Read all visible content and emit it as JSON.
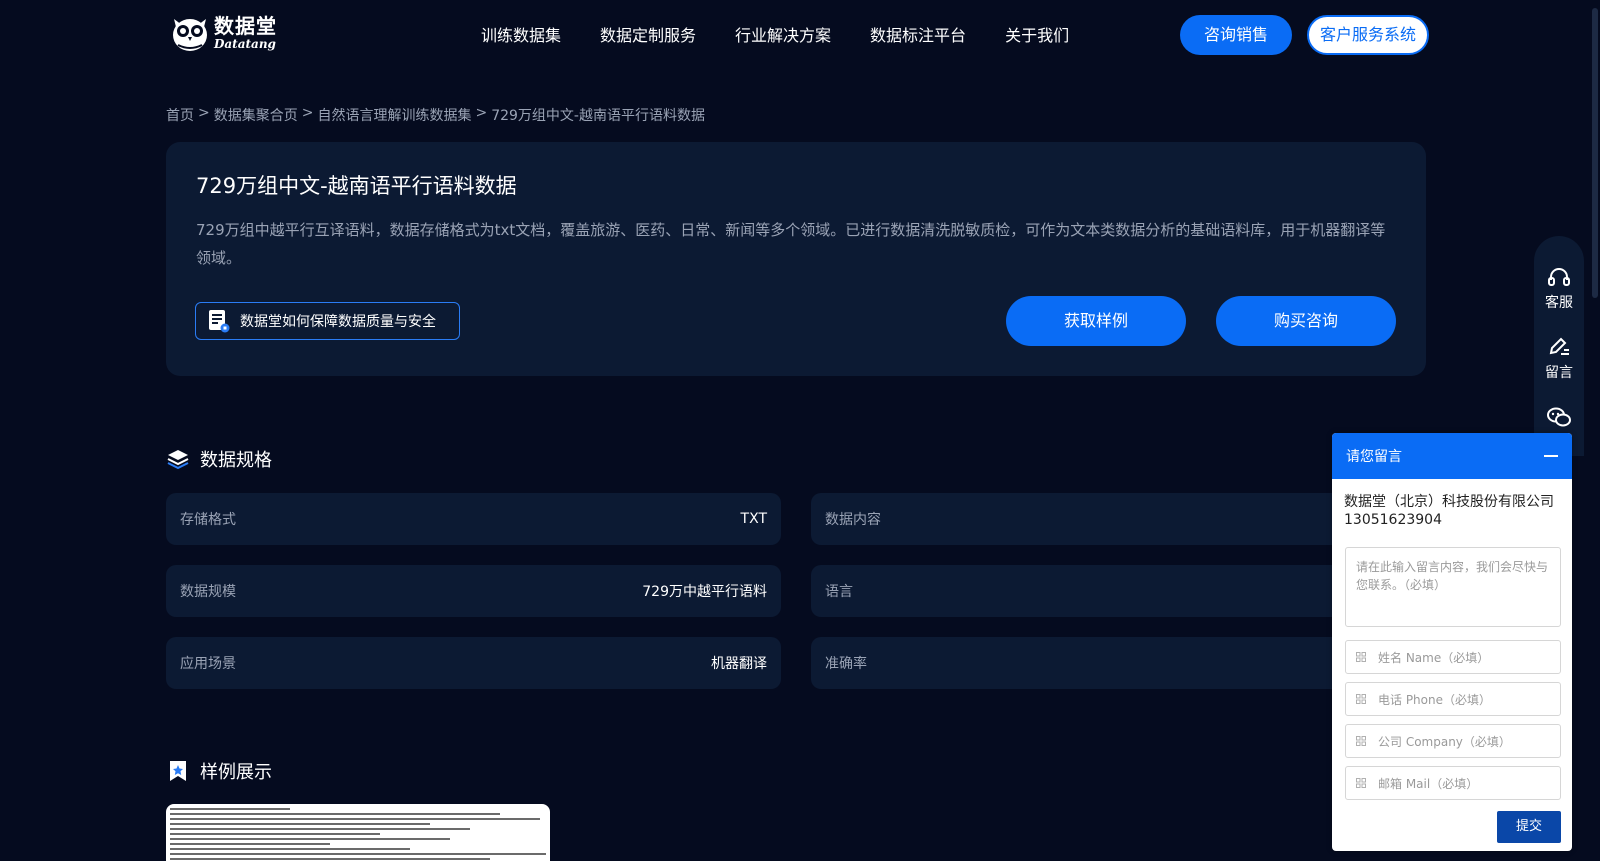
{
  "header": {
    "logo_cn": "数据堂",
    "logo_en": "Datatang",
    "nav": [
      "训练数据集",
      "数据定制服务",
      "行业解决方案",
      "数据标注平台",
      "关于我们"
    ],
    "consult_label": "咨询销售",
    "service_label": "客户服务系统"
  },
  "breadcrumb": {
    "items": [
      "首页",
      "数据集聚合页",
      "自然语言理解训练数据集",
      "729万组中文-越南语平行语料数据"
    ],
    "separator": ">"
  },
  "hero": {
    "title": "729万组中文-越南语平行语料数据",
    "description": "729万组中越平行互译语料，数据存储格式为txt文档，覆盖旅游、医药、日常、新闻等多个领域。已进行数据清洗脱敏质检，可作为文本类数据分析的基础语料库，用于机器翻译等领域。",
    "quality_label": "数据堂如何保障数据质量与安全",
    "sample_label": "获取样例",
    "buy_label": "购买咨询"
  },
  "specs": {
    "title": "数据规格",
    "left": [
      {
        "label": "存储格式",
        "value": "TXT"
      },
      {
        "label": "数据规模",
        "value": "729万中越平行语料"
      },
      {
        "label": "应用场景",
        "value": "机器翻译"
      }
    ],
    "right": [
      {
        "label": "数据内容",
        "value": ""
      },
      {
        "label": "语言",
        "value": ""
      },
      {
        "label": "准确率",
        "value": ""
      }
    ]
  },
  "samples": {
    "title": "样例展示"
  },
  "sidebar": {
    "items": [
      {
        "label": "客服",
        "icon": "headset-icon"
      },
      {
        "label": "留言",
        "icon": "edit-icon"
      },
      {
        "label": "",
        "icon": "wechat-icon"
      }
    ]
  },
  "popup": {
    "title": "请您留言",
    "company": "数据堂（北京）科技股份有限公司",
    "phone": "13051623904",
    "message_placeholder": "请在此输入留言内容，我们会尽快与您联系。（必填）",
    "fields": [
      "姓名 Name（必填）",
      "电话 Phone（必填）",
      "公司 Company（必填）",
      "邮箱 Mail（必填）"
    ],
    "submit_label": "提交"
  },
  "colors": {
    "background": "#050b1f",
    "card": "#0c1a33",
    "accent": "#0a6cf5"
  }
}
